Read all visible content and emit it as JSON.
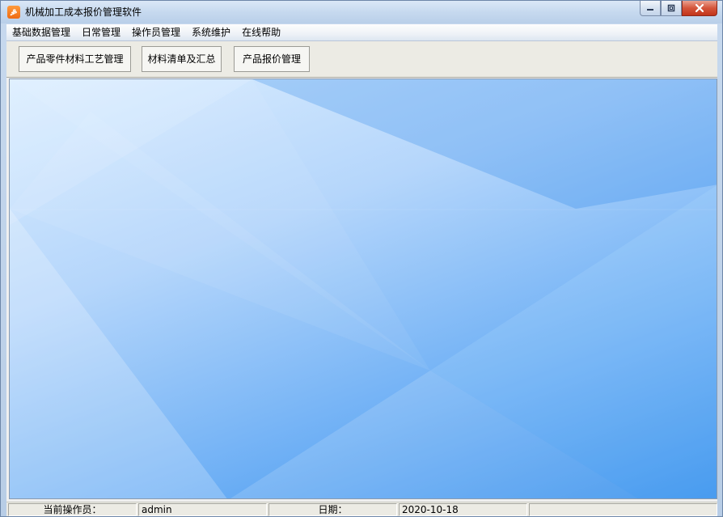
{
  "window": {
    "title": "机械加工成本报价管理软件",
    "icon_glyph": "ቇ",
    "icon": "app-logo-icon",
    "controls": {
      "minimize_icon": "minimize-icon",
      "restore_icon": "restore-icon",
      "close_icon": "close-icon"
    }
  },
  "menu": {
    "items": [
      {
        "label": "基础数据管理"
      },
      {
        "label": "日常管理"
      },
      {
        "label": "操作员管理"
      },
      {
        "label": "系统维护"
      },
      {
        "label": "在线帮助"
      }
    ]
  },
  "toolbar": {
    "buttons": [
      {
        "label": "产品零件材料工艺管理"
      },
      {
        "label": "材料清单及汇总"
      },
      {
        "label": "产品报价管理"
      }
    ]
  },
  "statusbar": {
    "operator_label": "当前操作员：",
    "operator_value": "admin",
    "date_label": "日期：",
    "date_value": "2020-10-18"
  },
  "colors": {
    "background_gradient": [
      "#dceeff",
      "#b5d6fb",
      "#6fb0f5",
      "#2f8cec"
    ],
    "close_button": "#c2341a",
    "icon_accent": "#ef6a12"
  }
}
